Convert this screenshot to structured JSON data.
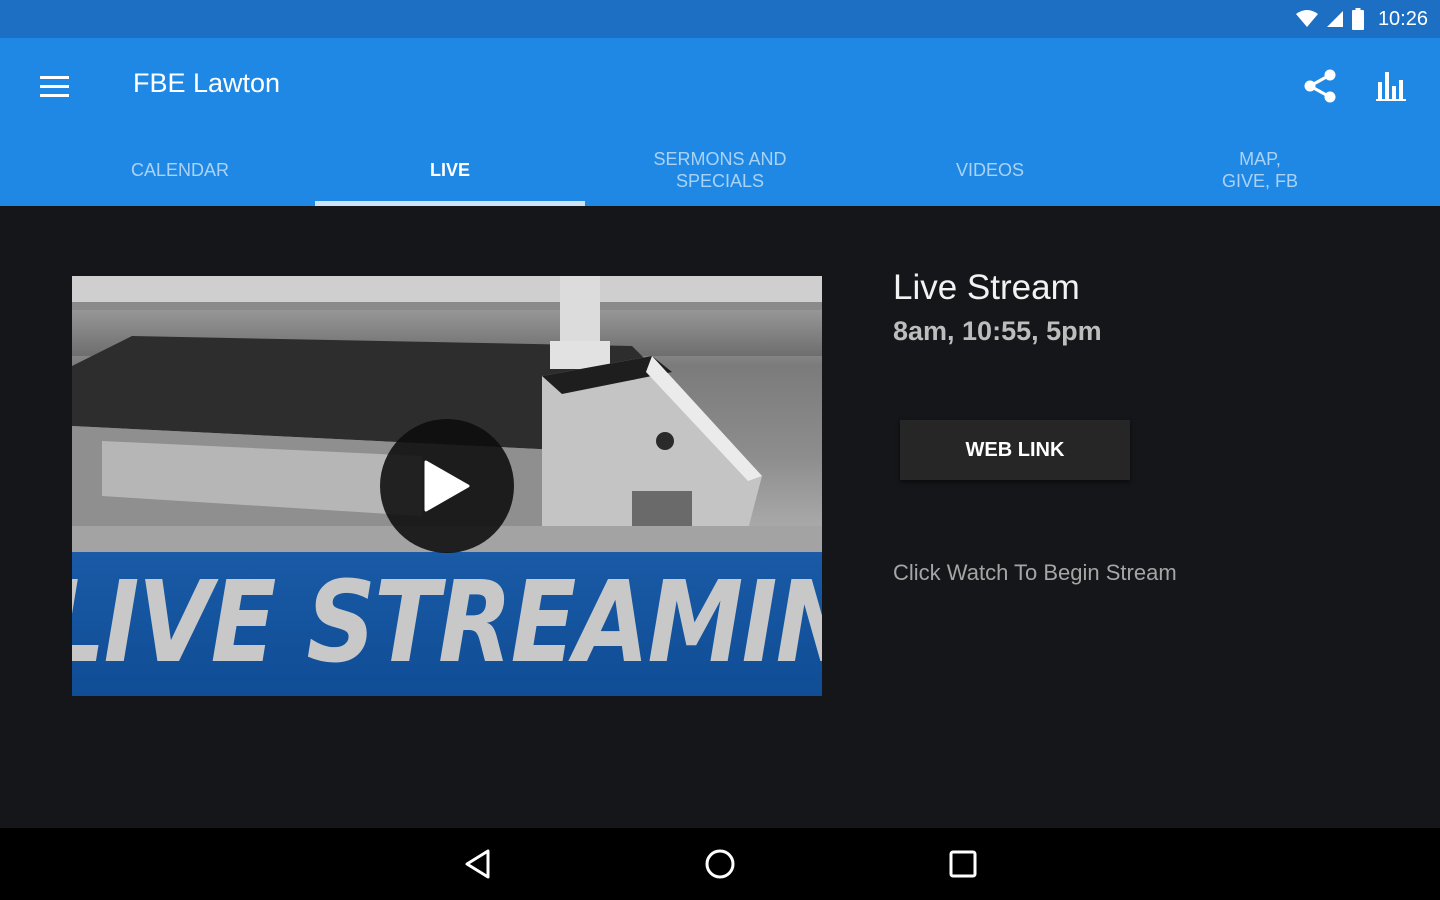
{
  "status_bar": {
    "time": "10:26",
    "icons": [
      "wifi-icon",
      "cell-signal-icon",
      "battery-icon"
    ]
  },
  "app_bar": {
    "title": "FBE Lawton",
    "menu_icon": "hamburger-menu-icon",
    "actions": [
      "share-icon",
      "bar-chart-icon"
    ],
    "color": "#1f88e5",
    "status_color": "#1d6fc4"
  },
  "tabs": [
    {
      "label": "Calendar",
      "active": false
    },
    {
      "label": "Live",
      "active": true
    },
    {
      "label": "Sermons and\nSpecials",
      "active": false
    },
    {
      "label": "Videos",
      "active": false
    },
    {
      "label": "Map,\nGive, FB",
      "active": false
    }
  ],
  "live": {
    "thumbnail_text": "LIVE STREAMING",
    "play_icon": "play-icon",
    "title": "Live Stream",
    "times": "8am, 10:55, 5pm",
    "web_link_label": "WEB LINK",
    "hint": "Click Watch To Begin Stream"
  },
  "nav_bar": {
    "buttons": [
      "back-icon",
      "home-icon",
      "recents-icon"
    ]
  },
  "colors": {
    "background": "#151619",
    "banner": "#1a5aa6",
    "active_indicator": "#cfe3f7"
  }
}
